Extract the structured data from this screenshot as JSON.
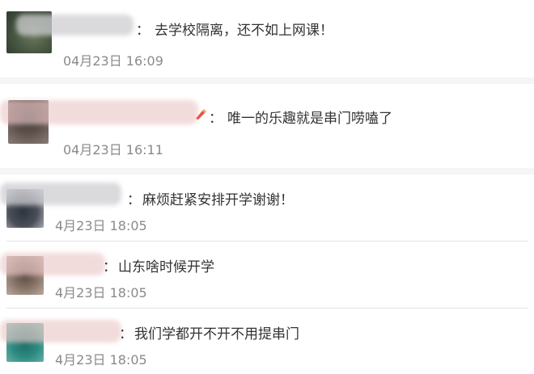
{
  "comments": [
    {
      "separator": "：",
      "text": "去学校隔离，还不如上网课！",
      "time": "04月23日 16:09"
    },
    {
      "separator": "：",
      "text": "唯一的乐趣就是串门唠嗑了",
      "time": "04月23日 16:11"
    },
    {
      "separator": "：",
      "text": "麻烦赶紧安排开学谢谢！",
      "time": "4月23日 18:05"
    },
    {
      "separator": "：",
      "text": "山东啥时候开学",
      "time": "4月23日 18:05"
    },
    {
      "separator": "：",
      "text": "我们学都开不开不用提串门",
      "time": "4月23日 18:05"
    }
  ],
  "colors": {
    "background": "#f4f5f7",
    "card": "#ffffff",
    "text": "#333333",
    "time": "#8a8a8a",
    "divider": "#e3e3e3"
  }
}
